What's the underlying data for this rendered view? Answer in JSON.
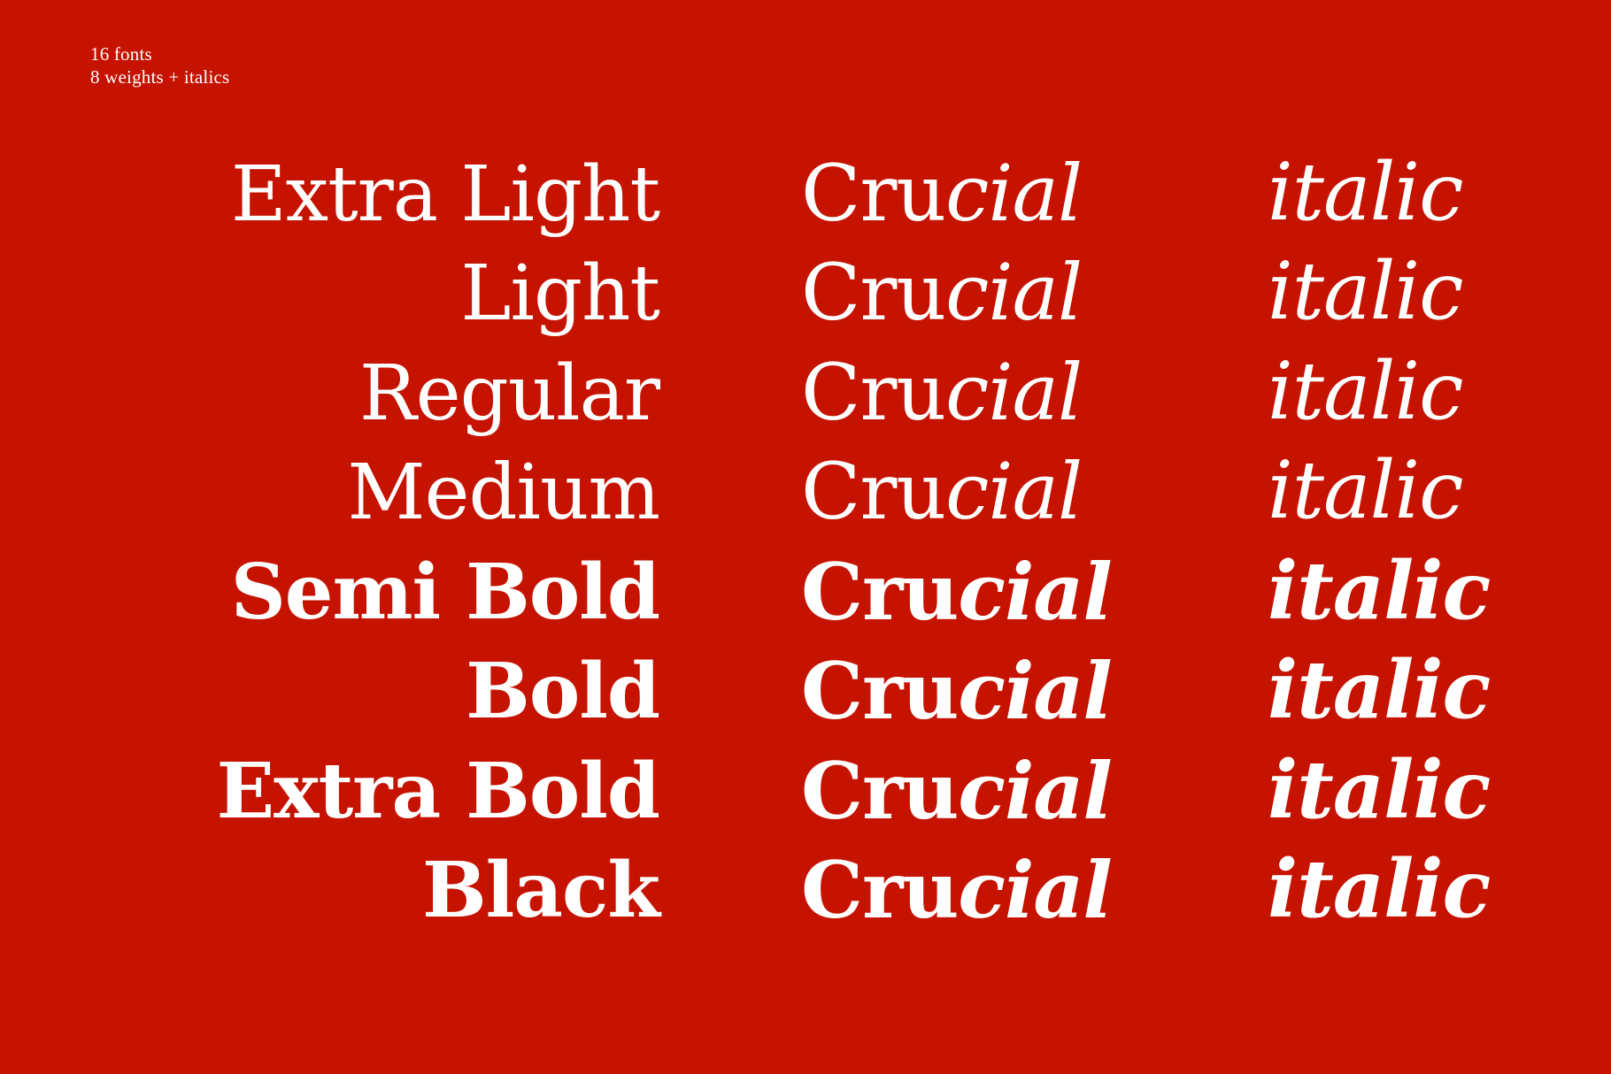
{
  "caption": {
    "line1": "16 fonts",
    "line2": "8 weights + italics"
  },
  "colors": {
    "background": "#c51300",
    "text": "#ffffff"
  },
  "rows": [
    {
      "weight": "Extra Light",
      "sample_roman": "Cru",
      "sample_italic": "cial",
      "italic_word": "italic"
    },
    {
      "weight": "Light",
      "sample_roman": "Cru",
      "sample_italic": "cial",
      "italic_word": "italic"
    },
    {
      "weight": "Regular",
      "sample_roman": "Cru",
      "sample_italic": "cial",
      "italic_word": "italic"
    },
    {
      "weight": "Medium",
      "sample_roman": "Cru",
      "sample_italic": "cial",
      "italic_word": "italic"
    },
    {
      "weight": "Semi Bold",
      "sample_roman": "Cru",
      "sample_italic": "cial",
      "italic_word": "italic"
    },
    {
      "weight": "Bold",
      "sample_roman": "Cru",
      "sample_italic": "cial",
      "italic_word": "italic"
    },
    {
      "weight": "Extra Bold",
      "sample_roman": "Cru",
      "sample_italic": "cial",
      "italic_word": "italic"
    },
    {
      "weight": "Black",
      "sample_roman": "Cru",
      "sample_italic": "cial",
      "italic_word": "italic"
    }
  ]
}
